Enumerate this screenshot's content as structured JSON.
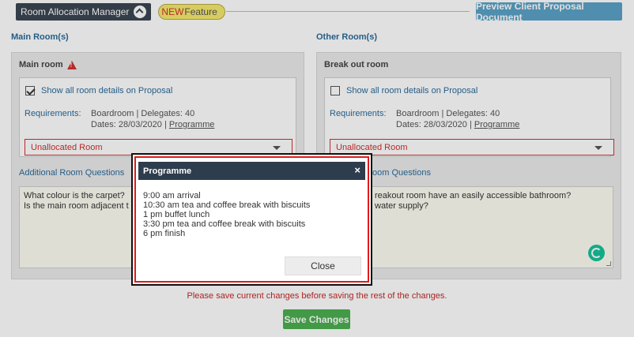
{
  "header": {
    "manager_label": "Room Allocation Manager",
    "badge_new": "NEW",
    "badge_feature": "Feature",
    "preview_button": "Preview Client Proposal Document"
  },
  "sections": {
    "main_title": "Main Room(s)",
    "other_title": "Other Room(s)"
  },
  "main_room": {
    "name": "Main room",
    "show_details": "Show all room details on Proposal",
    "show_details_checked": true,
    "requirements_label": "Requirements:",
    "req_line1": "Boardroom | Delegates: 40",
    "req_dates": "Dates: 28/03/2020 |",
    "req_programme": "Programme",
    "select_value": "Unallocated Room",
    "aq_label": "Additional Room Questions",
    "aq_line1": "What colour is the carpet?",
    "aq_line2": "Is the main room adjacent t"
  },
  "other_room": {
    "name": "Break out room",
    "show_details": "Show all room details on Proposal",
    "show_details_checked": false,
    "requirements_label": "Requirements:",
    "req_line1": "Boardroom | Delegates: 40",
    "req_dates": "Dates: 28/03/2020 |",
    "req_programme": "Programme",
    "select_value": "Unallocated Room",
    "aq_label": "oom Questions",
    "aq_line1": "reakout room have an easily accessible bathroom?",
    "aq_line2": "water supply?"
  },
  "footer": {
    "warning": "Please save current changes before saving the rest of the changes.",
    "save_button": "Save Changes"
  },
  "modal": {
    "title": "Programme",
    "close_x": "×",
    "lines": [
      "9:00 am arrival",
      "10:30 am tea and coffee break with biscuits",
      "1 pm buffet lunch",
      "3:30 pm tea and coffee break with biscuits",
      "6 pm finish"
    ],
    "close_button": "Close"
  },
  "colors": {
    "accent_blue": "#2a6b9b",
    "error_red": "#d32f2f",
    "save_green": "#4caf50",
    "header_dark": "#2e3d4d"
  }
}
